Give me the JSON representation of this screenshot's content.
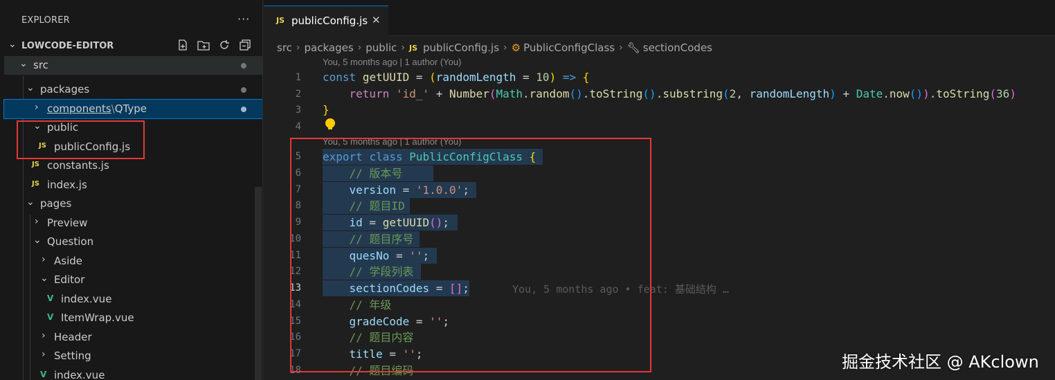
{
  "sidebar": {
    "title": "EXPLORER",
    "more": "···",
    "project": "LOWCODE-EDITOR",
    "items": [
      {
        "label": "src"
      },
      {
        "label": "packages"
      },
      {
        "label_a": "components",
        "sep": "\\",
        "label_b": "QType"
      },
      {
        "label": "public"
      },
      {
        "badge": "JS",
        "label": "publicConfig.js"
      },
      {
        "badge": "JS",
        "label": "constants.js"
      },
      {
        "badge": "JS",
        "label": "index.js"
      },
      {
        "label": "pages"
      },
      {
        "label": "Preview"
      },
      {
        "label": "Question"
      },
      {
        "label": "Aside"
      },
      {
        "label": "Editor"
      },
      {
        "label": "index.vue"
      },
      {
        "label": "ItemWrap.vue"
      },
      {
        "label": "Header"
      },
      {
        "label": "Setting"
      },
      {
        "label": "index.vue"
      }
    ]
  },
  "tab": {
    "badge": "JS",
    "name": "publicConfig.js",
    "close": "✕"
  },
  "breadcrumb": {
    "src": "src",
    "packages": "packages",
    "public": "public",
    "file": "publicConfig.js",
    "cls": "PublicConfigClass",
    "member": "sectionCodes"
  },
  "editor": {
    "codelens_1": "You, 5 months ago | 1 author (You)",
    "codelens_2": "You, 5 months ago | 1 author (You)",
    "line_numbers": [
      "1",
      "2",
      "3",
      "4",
      "5",
      "6",
      "7",
      "8",
      "9",
      "10",
      "11",
      "12",
      "13",
      "14",
      "15",
      "16",
      "17",
      "18"
    ],
    "active_line": "13",
    "blame": "You, 5 months ago • feat: 基础结构 …",
    "comments": {
      "version": "// 版本号",
      "id": "// 题目ID",
      "quesNo": "// 题目序号",
      "sectionCodes": "// 学段列表",
      "gradeCode": "// 年级",
      "title": "// 题目内容",
      "code": "// 题目编码"
    },
    "tokens": {
      "const": "const",
      "getUUID": "getUUID",
      "randomLength": "randomLength",
      "ten": "10",
      "return": "return",
      "id_str": "'id_'",
      "Number": "Number",
      "Math": "Math",
      "random": "random",
      "toString": "toString",
      "substring": "substring",
      "two": "2",
      "Date": "Date",
      "now": "now",
      "n36": "36",
      "export": "export",
      "class": "class",
      "PublicConfigClass": "PublicConfigClass",
      "version": "version",
      "version_val": "'1.0.0'",
      "id": "id",
      "quesNo": "quesNo",
      "empty_str": "''",
      "sectionCodes": "sectionCodes",
      "gradeCode": "gradeCode",
      "title": "title"
    }
  },
  "watermark": "掘金技术社区 @ AKclown"
}
